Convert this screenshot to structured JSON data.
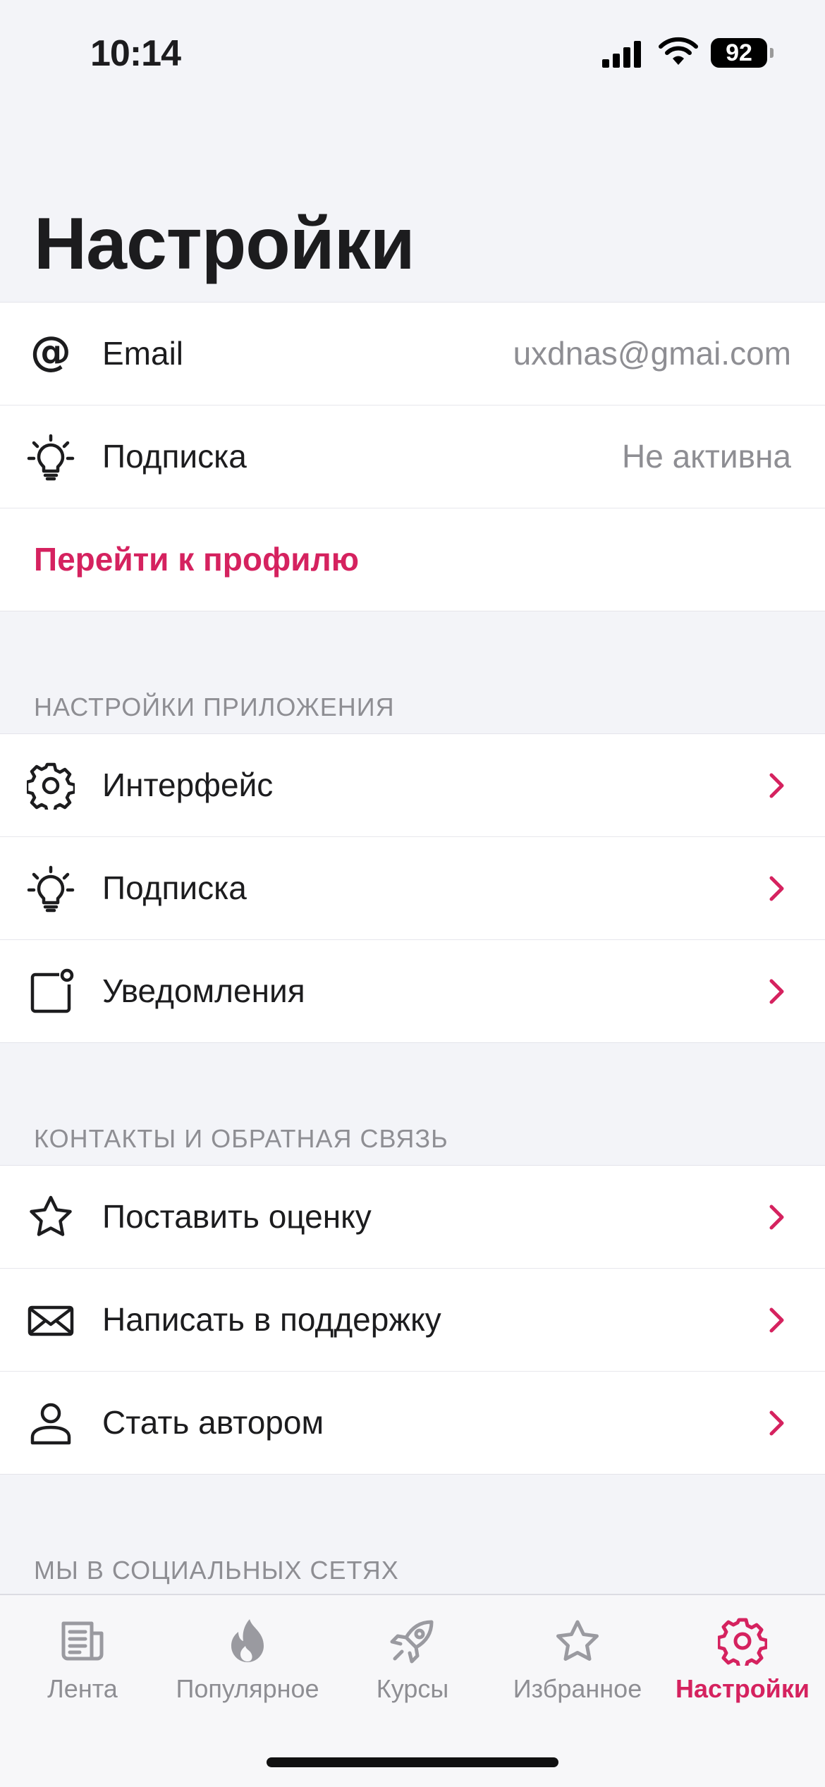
{
  "status": {
    "time": "10:14",
    "battery": "92"
  },
  "title": "Настройки",
  "account": {
    "email": {
      "label": "Email",
      "value": "uxdnas@gmai.com",
      "icon": "at-icon"
    },
    "subscription": {
      "label": "Подписка",
      "value": "Не активна",
      "icon": "lightbulb-icon"
    },
    "profile_link": "Перейти к профилю"
  },
  "app_settings": {
    "header": "НАСТРОЙКИ ПРИЛОЖЕНИЯ",
    "items": [
      {
        "label": "Интерфейс",
        "icon": "gear-icon"
      },
      {
        "label": "Подписка",
        "icon": "lightbulb-icon"
      },
      {
        "label": "Уведомления",
        "icon": "notification-icon"
      }
    ]
  },
  "contacts": {
    "header": "КОНТАКТЫ И ОБРАТНАЯ СВЯЗЬ",
    "items": [
      {
        "label": "Поставить оценку",
        "icon": "star-icon"
      },
      {
        "label": "Написать в поддержку",
        "icon": "envelope-icon"
      },
      {
        "label": "Стать автором",
        "icon": "person-icon"
      }
    ]
  },
  "social": {
    "header": "МЫ В СОЦИАЛЬНЫХ СЕТЯХ"
  },
  "tabs": [
    {
      "label": "Лента",
      "icon": "newspaper-icon",
      "active": false
    },
    {
      "label": "Популярное",
      "icon": "flame-icon",
      "active": false
    },
    {
      "label": "Курсы",
      "icon": "rocket-icon",
      "active": false
    },
    {
      "label": "Избранное",
      "icon": "star-icon",
      "active": false
    },
    {
      "label": "Настройки",
      "icon": "gear-icon",
      "active": true
    }
  ],
  "colors": {
    "accent": "#D5225F",
    "secondary_text": "#8E8E93",
    "background": "#F3F4F8"
  }
}
